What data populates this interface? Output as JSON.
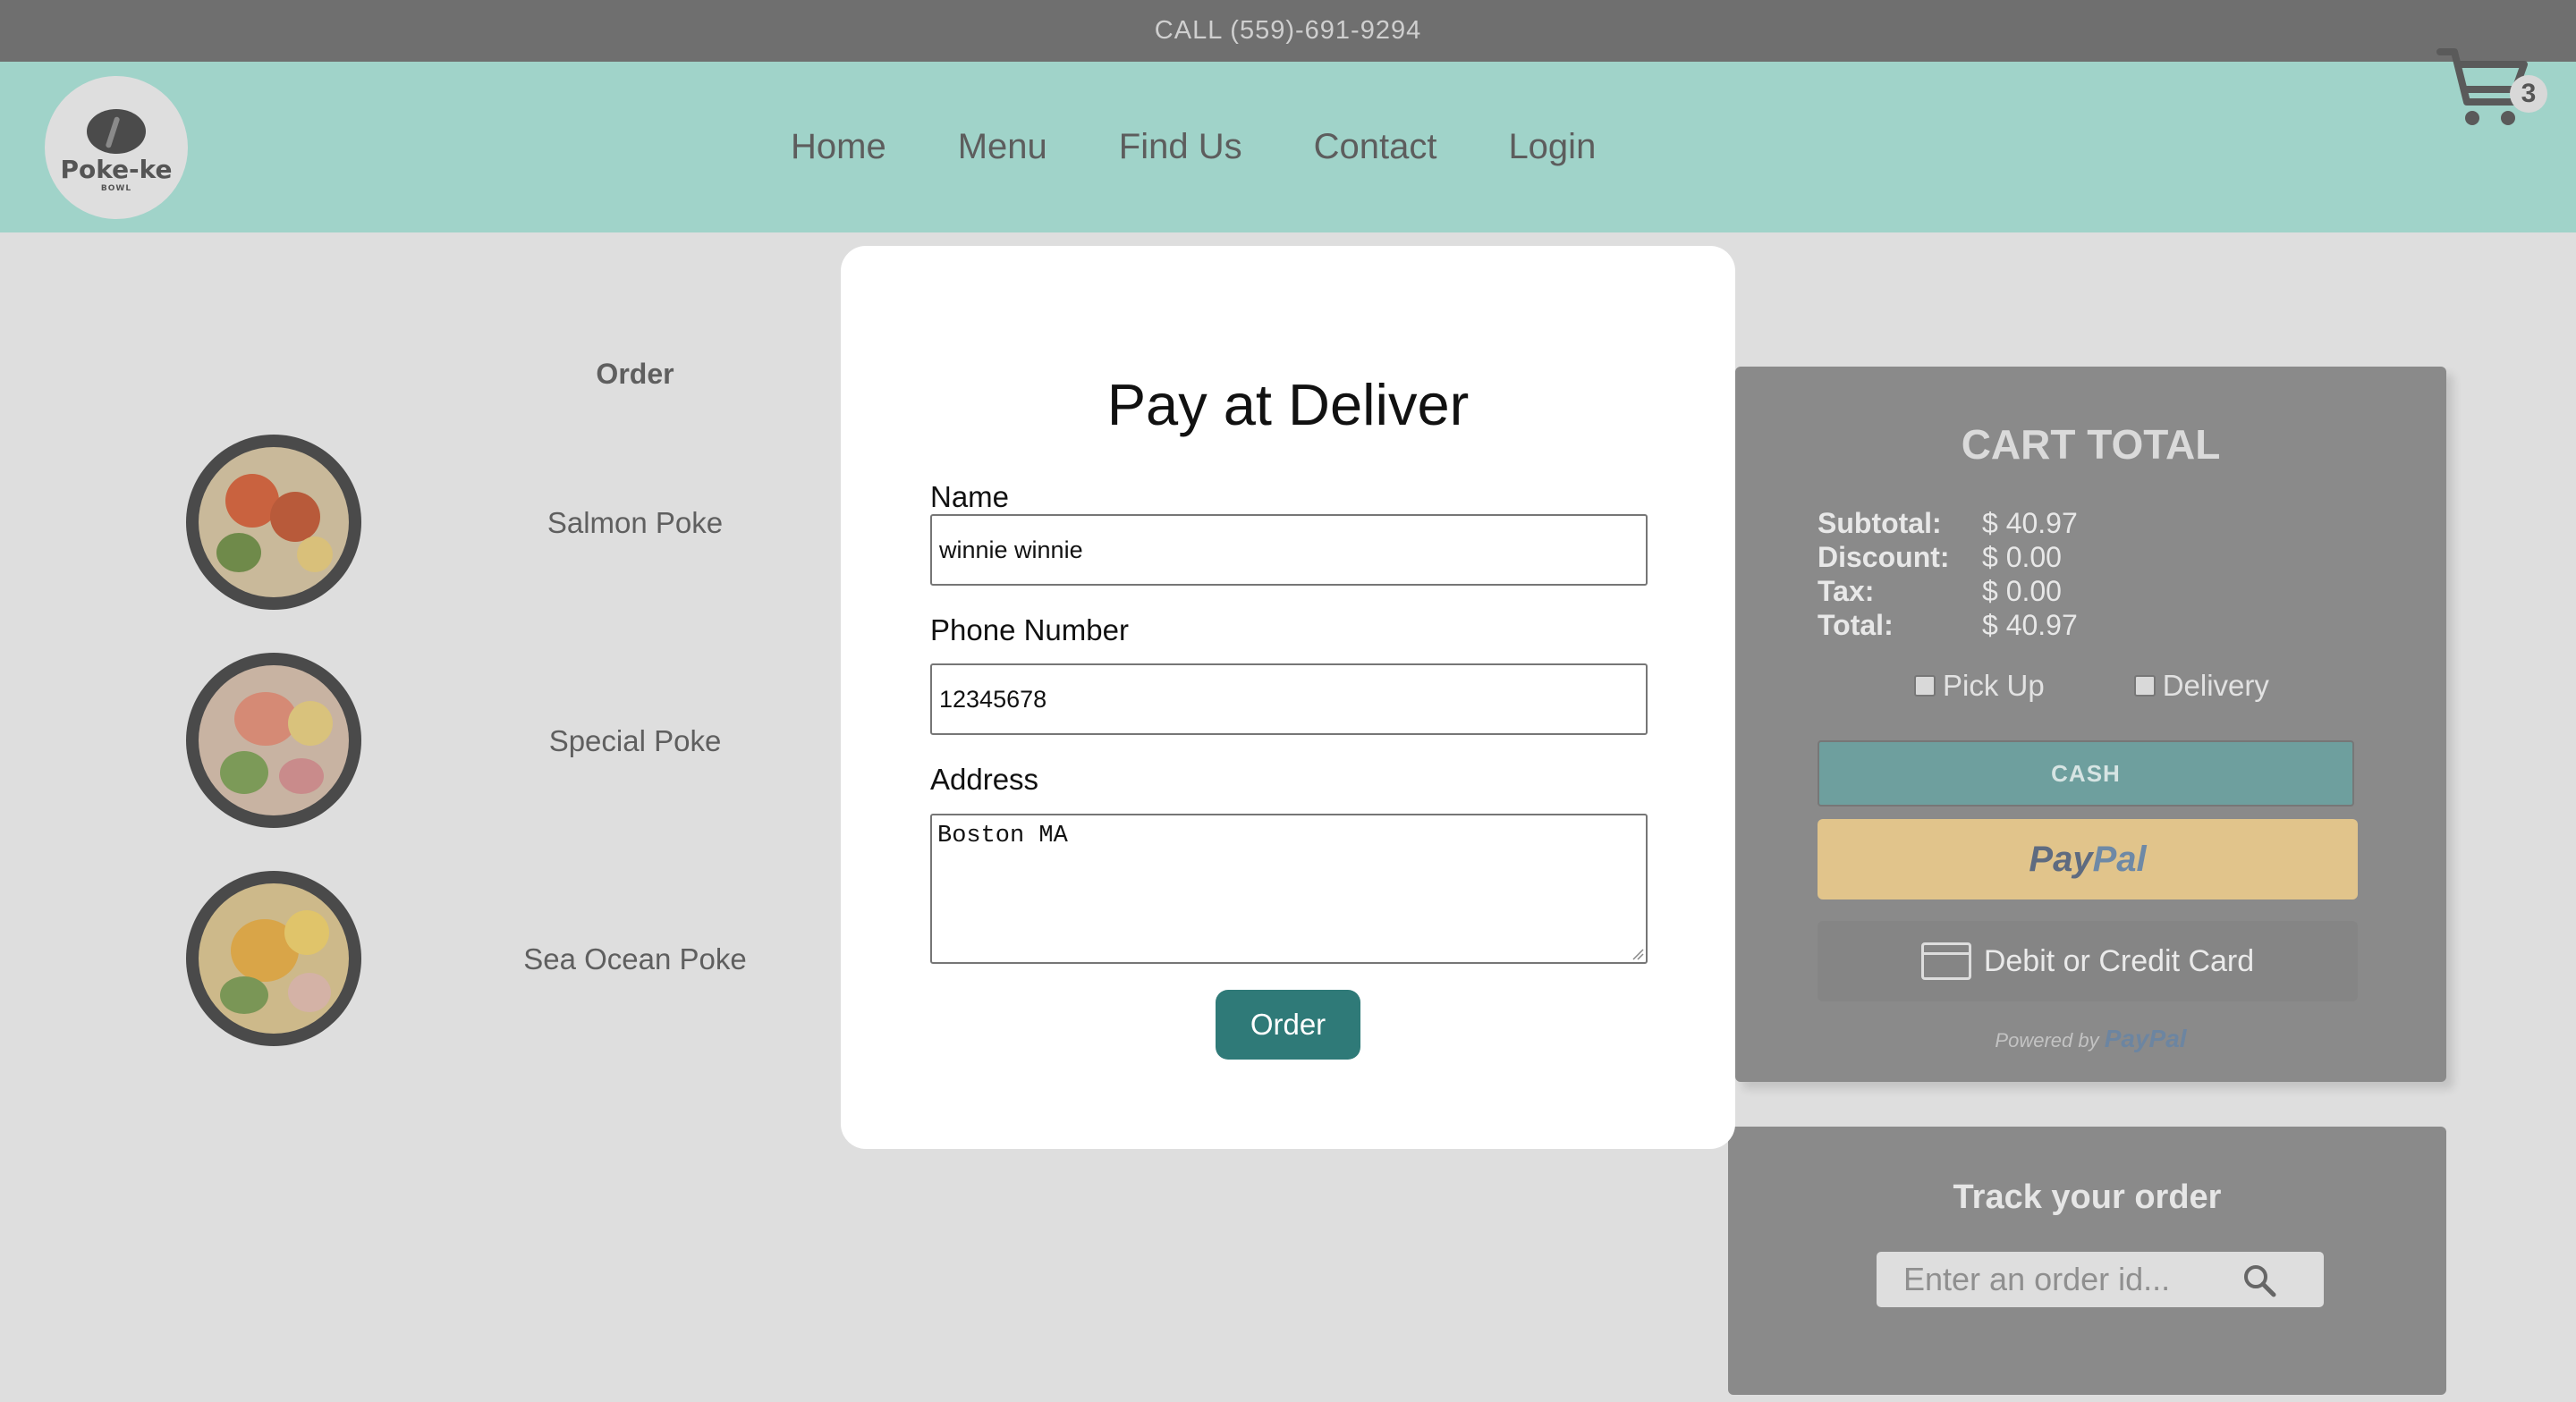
{
  "topbar": {
    "phone_text": "CALL (559)-691-9294"
  },
  "header": {
    "logo_text": "Poke-ke",
    "logo_sub": "BOWL",
    "nav": [
      "Home",
      "Menu",
      "Find Us",
      "Contact",
      "Login"
    ],
    "cart_count": "3"
  },
  "order": {
    "heading": "Order",
    "items": [
      {
        "name": "Salmon Poke"
      },
      {
        "name": "Special Poke"
      },
      {
        "name": "Sea Ocean Poke"
      }
    ]
  },
  "cart_total": {
    "title": "CART TOTAL",
    "rows": [
      {
        "label": "Subtotal:",
        "value": "$ 40.97"
      },
      {
        "label": "Discount:",
        "value": "$ 0.00"
      },
      {
        "label": "Tax:",
        "value": "$ 0.00"
      },
      {
        "label": "Total:",
        "value": "$ 40.97"
      }
    ],
    "pickup_label": "Pick Up",
    "delivery_label": "Delivery",
    "cash_label": "CASH",
    "paypal_part1": "Pay",
    "paypal_part2": "Pal",
    "card_label": "Debit or Credit Card",
    "powered_by": "Powered by",
    "powered_brand": "PayPal"
  },
  "track": {
    "title": "Track your order",
    "placeholder": "Enter an order id..."
  },
  "modal": {
    "title": "Pay at Deliver",
    "name_label": "Name",
    "name_value": "winnie winnie",
    "phone_label": "Phone Number",
    "phone_value": "12345678",
    "address_label": "Address",
    "address_value": "Boston MA",
    "order_button": "Order"
  },
  "colors": {
    "header_bg": "#a0d3c9",
    "topbar_bg": "#6f6f6f",
    "overlay_bg": "#dedede",
    "order_button": "#2f7a78",
    "cash_button": "#6e9f9e",
    "paypal_button": "#e1c48b"
  }
}
